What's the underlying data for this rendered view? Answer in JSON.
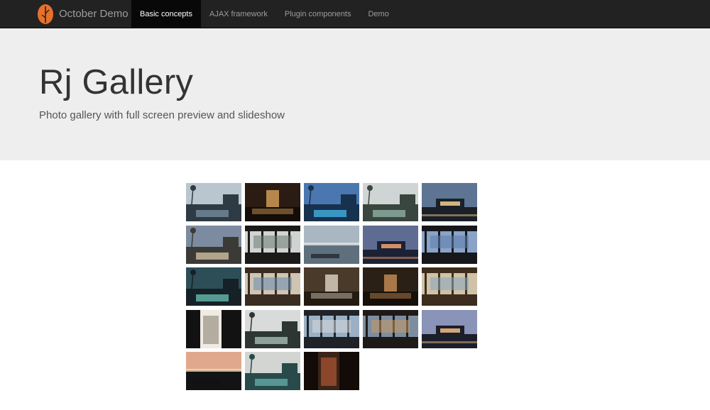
{
  "brand": {
    "name": "October Demo"
  },
  "nav": {
    "items": [
      {
        "label": "Basic concepts",
        "active": true
      },
      {
        "label": "AJAX framework",
        "active": false
      },
      {
        "label": "Plugin components",
        "active": false
      },
      {
        "label": "Demo",
        "active": false
      }
    ]
  },
  "hero": {
    "title": "Rj Gallery",
    "subtitle": "Photo gallery with full screen preview and slideshow"
  },
  "gallery": {
    "columns": 5,
    "thumbnails": [
      {
        "sky": "#b9c6cf",
        "ground": "#2e3a44",
        "accent": "#6e8796",
        "scene": "pool"
      },
      {
        "sky": "#2a1c12",
        "ground": "#130c07",
        "accent": "#d9a25c",
        "scene": "lounge"
      },
      {
        "sky": "#4b77b0",
        "ground": "#16324e",
        "accent": "#3fa8d8",
        "scene": "pool"
      },
      {
        "sky": "#cfd5d4",
        "ground": "#39463f",
        "accent": "#8aa89f",
        "scene": "villa"
      },
      {
        "sky": "#5d7592",
        "ground": "#1a2027",
        "accent": "#e5c48a",
        "scene": "house"
      },
      {
        "sky": "#7d8ba0",
        "ground": "#3c3a36",
        "accent": "#c7b69a",
        "scene": "villa"
      },
      {
        "sky": "#cfd3d1",
        "ground": "#1b1a18",
        "accent": "#6e7b74",
        "scene": "pavilion"
      },
      {
        "sky": "#a9b7c3",
        "ground": "#5e6f7d",
        "accent": "#e2e6e8",
        "scene": "ocean"
      },
      {
        "sky": "#5f6c92",
        "ground": "#1c2236",
        "accent": "#e89a6a",
        "scene": "dusk"
      },
      {
        "sky": "#8aa3c7",
        "ground": "#15171b",
        "accent": "#5d7dab",
        "scene": "interior"
      },
      {
        "sky": "#2e4e57",
        "ground": "#152126",
        "accent": "#5fb0a8",
        "scene": "pool"
      },
      {
        "sky": "#cfc5b2",
        "ground": "#3a2c20",
        "accent": "#6a8bb0",
        "scene": "interior"
      },
      {
        "sky": "#4a3a2a",
        "ground": "#231a12",
        "accent": "#e0d6c4",
        "scene": "bedroom"
      },
      {
        "sky": "#2b2016",
        "ground": "#16100a",
        "accent": "#c98f55",
        "scene": "lounge"
      },
      {
        "sky": "#cfc2a6",
        "ground": "#3d2d1e",
        "accent": "#8aa7c0",
        "scene": "interior"
      },
      {
        "sky": "#efeae2",
        "ground": "#121212",
        "accent": "#8a8276",
        "scene": "doorway"
      },
      {
        "sky": "#d8dbd9",
        "ground": "#2d3632",
        "accent": "#9fb3ae",
        "scene": "pool"
      },
      {
        "sky": "#9bb0c4",
        "ground": "#1f2328",
        "accent": "#d7dbde",
        "scene": "interior"
      },
      {
        "sky": "#7c8da0",
        "ground": "#1d1a17",
        "accent": "#c79a64",
        "scene": "interior"
      },
      {
        "sky": "#8a93b8",
        "ground": "#1c1e2c",
        "accent": "#e6b47c",
        "scene": "house"
      },
      {
        "sky": "#e0a88c",
        "ground": "#131316",
        "accent": "#f2d6b6",
        "scene": "sunset"
      },
      {
        "sky": "#d2d5d2",
        "ground": "#294a4a",
        "accent": "#5fa5a0",
        "scene": "villa"
      },
      {
        "sky": "#3a2418",
        "ground": "#120b07",
        "accent": "#c25d3a",
        "scene": "doorway"
      }
    ]
  }
}
